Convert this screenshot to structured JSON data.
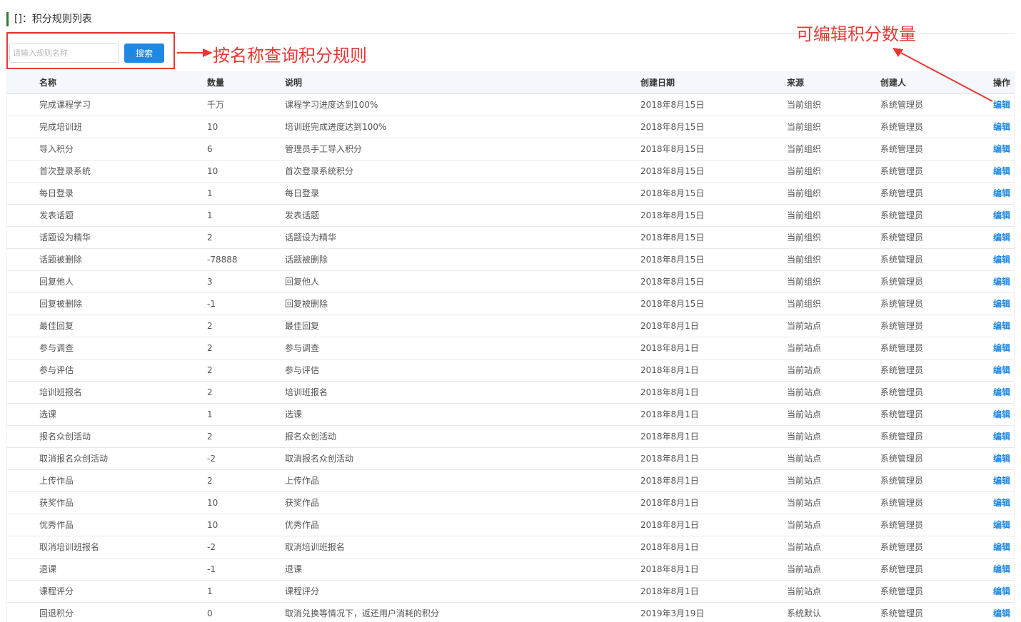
{
  "header": {
    "title": "[]：积分规则列表"
  },
  "search": {
    "placeholder": "请输入规则名称",
    "button_label": "搜索"
  },
  "annotations": {
    "search_note": "按名称查询积分规则",
    "edit_note": "可编辑积分数量",
    "color": "#e53935"
  },
  "table": {
    "columns": [
      "名称",
      "数量",
      "说明",
      "创建日期",
      "来源",
      "创建人",
      "操作"
    ],
    "rows": [
      {
        "name": "完成课程学习",
        "qty": "千万",
        "desc": "课程学习进度达到100%",
        "date": "2018年8月15日",
        "source": "当前组织",
        "creator": "系统管理员",
        "action": "编辑"
      },
      {
        "name": "完成培训班",
        "qty": "10",
        "desc": "培训班完成进度达到100%",
        "date": "2018年8月15日",
        "source": "当前组织",
        "creator": "系统管理员",
        "action": "编辑"
      },
      {
        "name": "导入积分",
        "qty": "6",
        "desc": "管理员手工导入积分",
        "date": "2018年8月15日",
        "source": "当前组织",
        "creator": "系统管理员",
        "action": "编辑"
      },
      {
        "name": "首次登录系统",
        "qty": "10",
        "desc": "首次登录系统积分",
        "date": "2018年8月15日",
        "source": "当前组织",
        "creator": "系统管理员",
        "action": "编辑"
      },
      {
        "name": "每日登录",
        "qty": "1",
        "desc": "每日登录",
        "date": "2018年8月15日",
        "source": "当前组织",
        "creator": "系统管理员",
        "action": "编辑"
      },
      {
        "name": "发表话题",
        "qty": "1",
        "desc": "发表话题",
        "date": "2018年8月15日",
        "source": "当前组织",
        "creator": "系统管理员",
        "action": "编辑"
      },
      {
        "name": "话题设为精华",
        "qty": "2",
        "desc": "话题设为精华",
        "date": "2018年8月15日",
        "source": "当前组织",
        "creator": "系统管理员",
        "action": "编辑"
      },
      {
        "name": "话题被删除",
        "qty": "-78888",
        "desc": "话题被删除",
        "date": "2018年8月15日",
        "source": "当前组织",
        "creator": "系统管理员",
        "action": "编辑"
      },
      {
        "name": "回复他人",
        "qty": "3",
        "desc": "回复他人",
        "date": "2018年8月15日",
        "source": "当前组织",
        "creator": "系统管理员",
        "action": "编辑"
      },
      {
        "name": "回复被删除",
        "qty": "-1",
        "desc": "回复被删除",
        "date": "2018年8月15日",
        "source": "当前组织",
        "creator": "系统管理员",
        "action": "编辑"
      },
      {
        "name": "最佳回复",
        "qty": "2",
        "desc": "最佳回复",
        "date": "2018年8月1日",
        "source": "当前站点",
        "creator": "系统管理员",
        "action": "编辑"
      },
      {
        "name": "参与调查",
        "qty": "2",
        "desc": "参与调查",
        "date": "2018年8月1日",
        "source": "当前站点",
        "creator": "系统管理员",
        "action": "编辑"
      },
      {
        "name": "参与评估",
        "qty": "2",
        "desc": "参与评估",
        "date": "2018年8月1日",
        "source": "当前站点",
        "creator": "系统管理员",
        "action": "编辑"
      },
      {
        "name": "培训班报名",
        "qty": "2",
        "desc": "培训班报名",
        "date": "2018年8月1日",
        "source": "当前站点",
        "creator": "系统管理员",
        "action": "编辑"
      },
      {
        "name": "选课",
        "qty": "1",
        "desc": "选课",
        "date": "2018年8月1日",
        "source": "当前站点",
        "creator": "系统管理员",
        "action": "编辑"
      },
      {
        "name": "报名众创活动",
        "qty": "2",
        "desc": "报名众创活动",
        "date": "2018年8月1日",
        "source": "当前站点",
        "creator": "系统管理员",
        "action": "编辑"
      },
      {
        "name": "取消报名众创活动",
        "qty": "-2",
        "desc": "取消报名众创活动",
        "date": "2018年8月1日",
        "source": "当前站点",
        "creator": "系统管理员",
        "action": "编辑"
      },
      {
        "name": "上传作品",
        "qty": "2",
        "desc": "上传作品",
        "date": "2018年8月1日",
        "source": "当前站点",
        "creator": "系统管理员",
        "action": "编辑"
      },
      {
        "name": "获奖作品",
        "qty": "10",
        "desc": "获奖作品",
        "date": "2018年8月1日",
        "source": "当前站点",
        "creator": "系统管理员",
        "action": "编辑"
      },
      {
        "name": "优秀作品",
        "qty": "10",
        "desc": "优秀作品",
        "date": "2018年8月1日",
        "source": "当前站点",
        "creator": "系统管理员",
        "action": "编辑"
      },
      {
        "name": "取消培训班报名",
        "qty": "-2",
        "desc": "取消培训班报名",
        "date": "2018年8月1日",
        "source": "当前站点",
        "creator": "系统管理员",
        "action": "编辑"
      },
      {
        "name": "退课",
        "qty": "-1",
        "desc": "退课",
        "date": "2018年8月1日",
        "source": "当前站点",
        "creator": "系统管理员",
        "action": "编辑"
      },
      {
        "name": "课程评分",
        "qty": "1",
        "desc": "课程评分",
        "date": "2018年8月1日",
        "source": "当前站点",
        "creator": "系统管理员",
        "action": "编辑"
      },
      {
        "name": "回退积分",
        "qty": "0",
        "desc": "取消兑换等情况下，返还用户消耗的积分",
        "date": "2019年3月19日",
        "source": "系统默认",
        "creator": "系统管理员",
        "action": "编辑"
      }
    ]
  }
}
